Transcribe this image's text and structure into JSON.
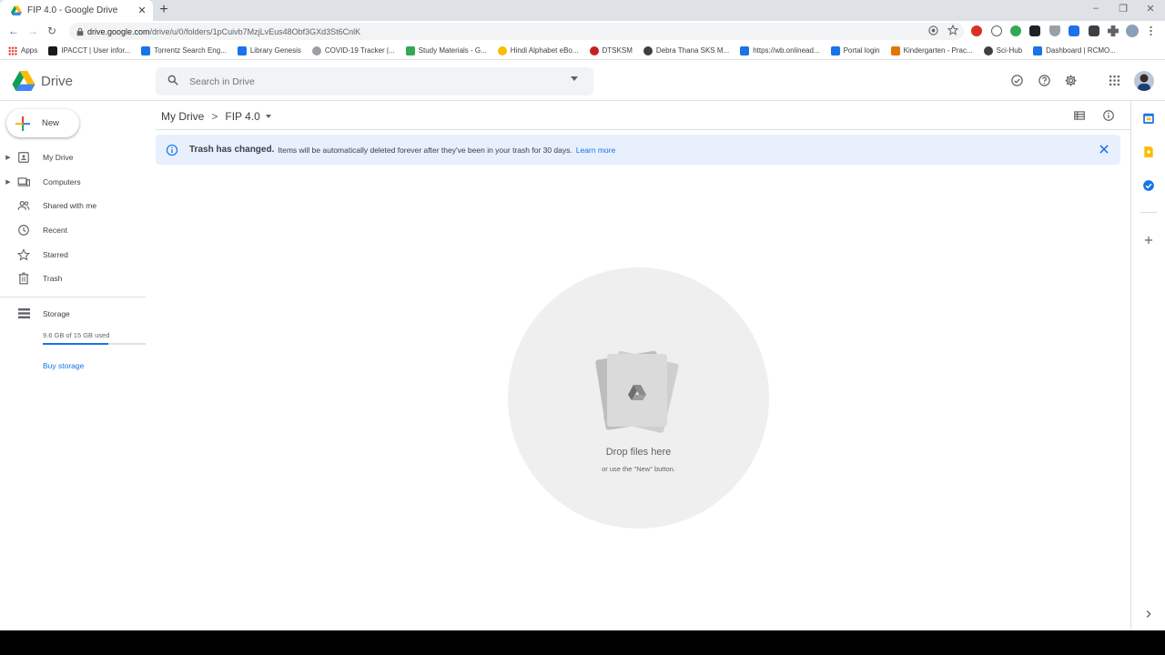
{
  "browser": {
    "tab": {
      "title": "FIP 4.0 - Google Drive",
      "close": "✕"
    },
    "new_tab": "+",
    "window": {
      "minimize": "–",
      "maximize": "❐",
      "close": "✕"
    },
    "nav": {
      "back": "←",
      "forward": "→",
      "reload": "↻"
    },
    "url_host": "drive.google.com",
    "url_path": "/drive/u/0/folders/1pCuivb7MzjLvEus48Obf3GXd3St6CnlK",
    "bookmarks": [
      {
        "label": "Apps",
        "icon": "apps-grid-icon",
        "color": "#ea4335"
      },
      {
        "label": "IPACCT | User infor...",
        "icon": "ip-icon",
        "color": "#1a1a1a"
      },
      {
        "label": "Torrentz Search Eng...",
        "icon": "t-icon",
        "color": "#1a73e8"
      },
      {
        "label": "Library Genesis",
        "icon": "library-icon",
        "color": "#1a73e8"
      },
      {
        "label": "COVID-19 Tracker |...",
        "icon": "covid-icon",
        "color": "#9aa0a6"
      },
      {
        "label": "Study Materials - G...",
        "icon": "drive-icon",
        "color": "#34a853"
      },
      {
        "label": "Hindi Alphabet eBo...",
        "icon": "chrome-icon",
        "color": "#fbbc04"
      },
      {
        "label": "DTSKSM",
        "icon": "circle-icon",
        "color": "#c5221f"
      },
      {
        "label": "Debra Thana SKS M...",
        "icon": "globe-icon",
        "color": "#3c4043"
      },
      {
        "label": "https://wb.onlinead...",
        "icon": "page-icon",
        "color": "#1a73e8"
      },
      {
        "label": "Portal login",
        "icon": "portal-icon",
        "color": "#1a73e8"
      },
      {
        "label": "Kindergarten - Prac...",
        "icon": "k-icon",
        "color": "#e37400"
      },
      {
        "label": "Sci-Hub",
        "icon": "globe-icon",
        "color": "#3c4043"
      },
      {
        "label": "Dashboard | RCMO...",
        "icon": "dashboard-icon",
        "color": "#1a73e8"
      }
    ]
  },
  "drive": {
    "brand": "Drive",
    "search_placeholder": "Search in Drive",
    "new_button": "New",
    "nav": [
      {
        "id": "my-drive",
        "label": "My Drive",
        "expandable": true
      },
      {
        "id": "computers",
        "label": "Computers",
        "expandable": true
      },
      {
        "id": "shared",
        "label": "Shared with me",
        "expandable": false
      },
      {
        "id": "recent",
        "label": "Recent",
        "expandable": false
      },
      {
        "id": "starred",
        "label": "Starred",
        "expandable": false
      },
      {
        "id": "trash",
        "label": "Trash",
        "expandable": false
      }
    ],
    "storage": {
      "label": "Storage",
      "used_text": "9.6 GB of 15 GB used",
      "used_fraction": 0.64,
      "buy": "Buy storage"
    },
    "breadcrumb": {
      "root": "My Drive",
      "separator": ">",
      "current": "FIP 4.0"
    },
    "banner": {
      "title": "Trash has changed.",
      "text": "Items will be automatically deleted forever after they've been in your trash for 30 days.",
      "link": "Learn more"
    },
    "empty_state": {
      "title": "Drop files here",
      "subtitle": "or use the \"New\" button."
    }
  },
  "colors": {
    "accent": "#1a73e8",
    "banner_bg": "#e8f0fe",
    "drop_circle": "#efefef"
  }
}
